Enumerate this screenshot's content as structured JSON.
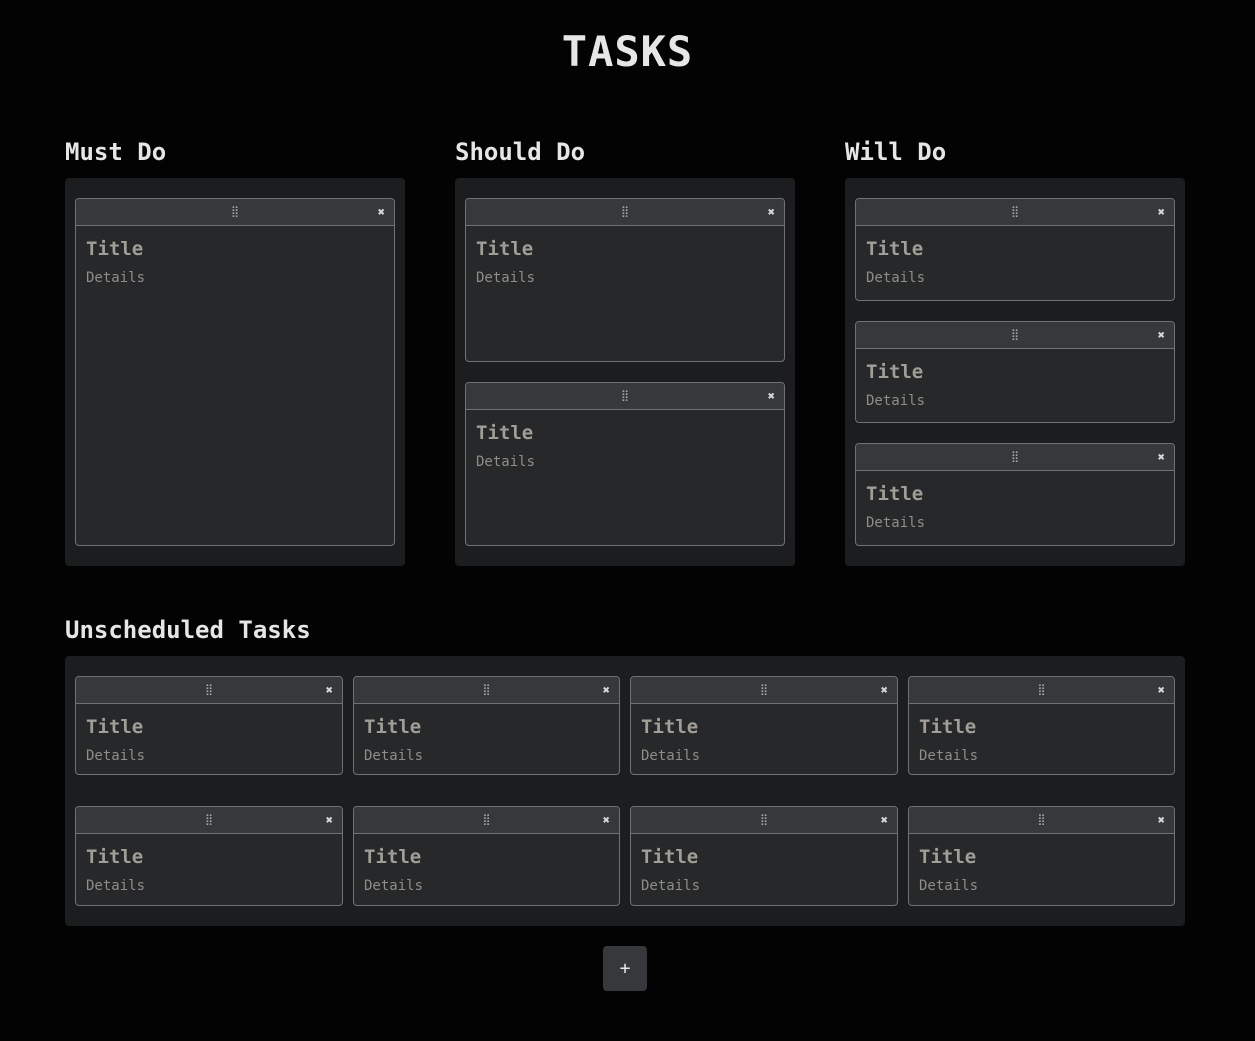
{
  "page": {
    "title": "TASKS"
  },
  "columns": [
    {
      "heading": "Must Do",
      "cards": [
        {
          "title": "Title",
          "details": "Details"
        }
      ]
    },
    {
      "heading": "Should Do",
      "cards": [
        {
          "title": "Title",
          "details": "Details"
        },
        {
          "title": "Title",
          "details": "Details"
        }
      ]
    },
    {
      "heading": "Will Do",
      "cards": [
        {
          "title": "Title",
          "details": "Details"
        },
        {
          "title": "Title",
          "details": "Details"
        },
        {
          "title": "Title",
          "details": "Details"
        }
      ]
    }
  ],
  "unscheduled": {
    "heading": "Unscheduled Tasks",
    "cards": [
      {
        "title": "Title",
        "details": "Details"
      },
      {
        "title": "Title",
        "details": "Details"
      },
      {
        "title": "Title",
        "details": "Details"
      },
      {
        "title": "Title",
        "details": "Details"
      },
      {
        "title": "Title",
        "details": "Details"
      },
      {
        "title": "Title",
        "details": "Details"
      },
      {
        "title": "Title",
        "details": "Details"
      },
      {
        "title": "Title",
        "details": "Details"
      }
    ]
  },
  "icons": {
    "drag": "drag-handle-icon",
    "close": "close-icon"
  },
  "glyphs": {
    "drag": "⣿",
    "close": "✖"
  },
  "add_button": {
    "label": "+"
  },
  "colors": {
    "background": "#030304",
    "panel": "#1c1d1e",
    "card": "#262829",
    "card_header": "#36383b",
    "border": "#6f7174"
  }
}
